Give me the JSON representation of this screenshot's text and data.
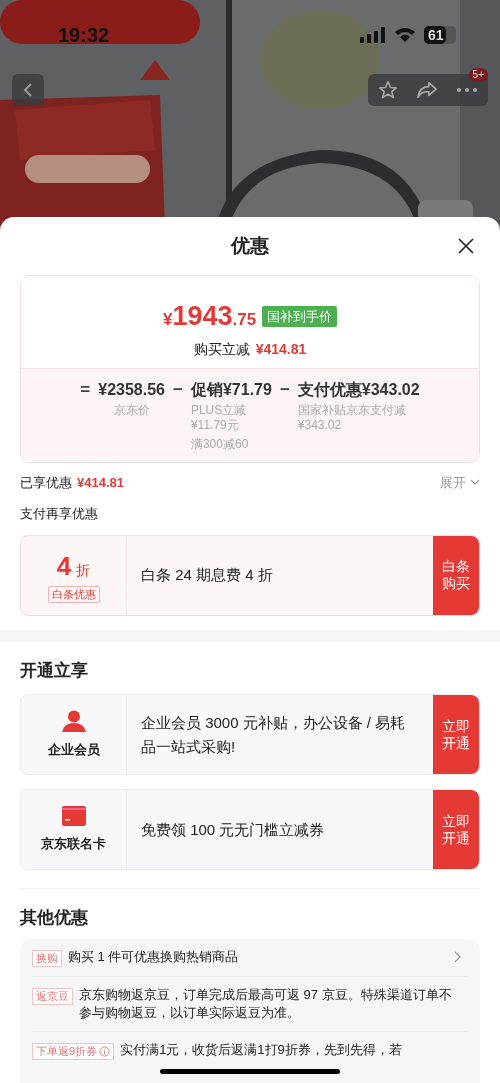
{
  "status_bar": {
    "time": "19:32",
    "battery": "61"
  },
  "nav": {
    "badge": "5+"
  },
  "sheet": {
    "title": "优惠"
  },
  "price_card": {
    "currency": "¥",
    "integer": "1943",
    "decimal": ".75",
    "tag": "国补到手价",
    "saving_label": "购买立减",
    "saving_amount": "¥414.81",
    "breakdown": [
      {
        "operator": "=",
        "amount": "¥2358.56",
        "notes": [
          "京东价"
        ]
      },
      {
        "operator": "−",
        "amount": "促销¥71.79",
        "notes": [
          "PLUS立减",
          "¥11.79元",
          "满300减60"
        ]
      },
      {
        "operator": "−",
        "amount": "支付优惠¥343.02",
        "notes": [
          "国家补贴京东支付减",
          "¥343.02"
        ]
      }
    ]
  },
  "enjoyed": {
    "label": "已享优惠",
    "amount": "¥414.81",
    "toggle": "展开"
  },
  "pay_section": {
    "title": "支付再享优惠",
    "offers": [
      {
        "discount": "4",
        "unit": "折",
        "tag": "白条优惠",
        "description": "白条 24 期息费 4 折",
        "action": "白条购买"
      }
    ]
  },
  "open_section": {
    "title": "开通立享",
    "offers": [
      {
        "kind": "person",
        "name": "企业会员",
        "description": "企业会员 3000 元补贴，办公设备 / 易耗品一站式采购!",
        "action": "立即开通"
      },
      {
        "kind": "card",
        "name": "京东联名卡",
        "description": "免费领 100 元无门槛立减券",
        "action": "立即开通"
      }
    ]
  },
  "other_section": {
    "title": "其他优惠",
    "items": [
      {
        "tag": "换购",
        "info": false,
        "text": "购买 1 件可优惠换购热销商品",
        "has_arrow": true
      },
      {
        "tag": "返京豆",
        "info": false,
        "text": "京东购物返京豆，订单完成后最高可返 97 京豆。特殊渠道订单不参与购物返豆，以订单实际返豆为准。",
        "has_arrow": false
      },
      {
        "tag": "下单返9折券",
        "info": true,
        "text": "实付满1元，收货后返满1打9折券，先到先得，若",
        "has_arrow": false
      }
    ]
  }
}
